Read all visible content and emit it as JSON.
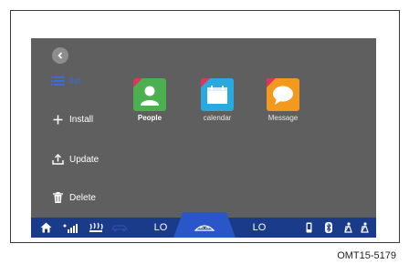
{
  "sidebar": {
    "items": [
      {
        "label": "list",
        "icon": "list-icon",
        "active": true
      },
      {
        "label": "Install",
        "icon": "plus-icon",
        "active": false
      },
      {
        "label": "Update",
        "icon": "upload-icon",
        "active": false
      },
      {
        "label": "Delete",
        "icon": "trash-icon",
        "active": false
      }
    ]
  },
  "apps": [
    {
      "label": "People",
      "icon": "people-icon",
      "color": "#4caf50"
    },
    {
      "label": "calendar",
      "icon": "calendar-icon",
      "color": "#2aa8e0"
    },
    {
      "label": "Message",
      "icon": "message-icon",
      "color": "#f39a1e"
    }
  ],
  "status_bar": {
    "left_temp": "LO",
    "right_temp": "LO",
    "icons": [
      "home-icon",
      "signal-icon",
      "seat-heat-icon",
      "car-icon",
      "defrost-icon",
      "phone-icon",
      "bluetooth-icon",
      "seatbelt-icon",
      "seatbelt-icon"
    ]
  },
  "footer": {
    "code": "OMT15-5179"
  },
  "colors": {
    "screen_bg": "#5f5f5f",
    "status_bar_bg": "#1a3a8a",
    "accent": "#3c6ae0"
  }
}
